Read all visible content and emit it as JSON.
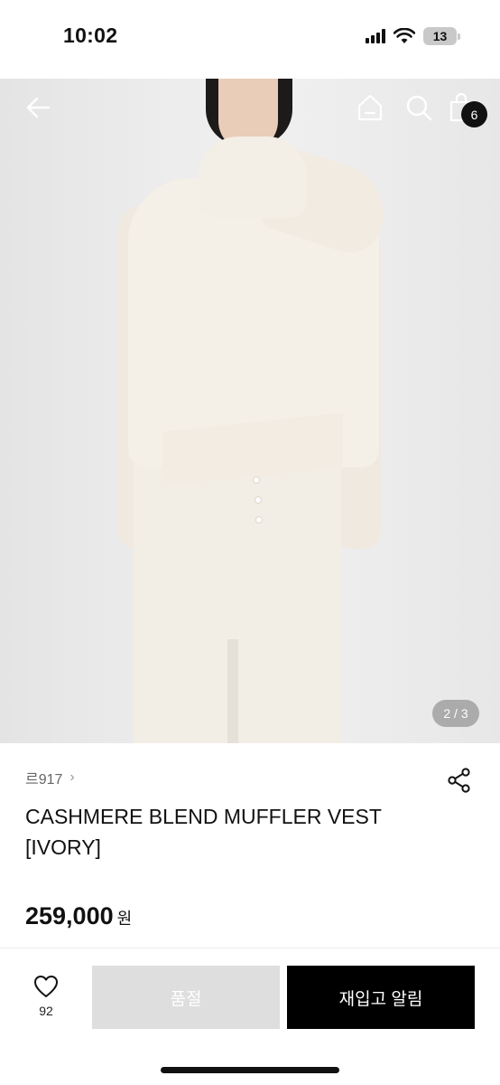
{
  "status_bar": {
    "time": "10:02",
    "battery": "13"
  },
  "header": {
    "bag_count": "6"
  },
  "gallery": {
    "indicator": "2 / 3"
  },
  "product": {
    "brand": "르917",
    "title": "CASHMERE BLEND MUFFLER VEST [IVORY]",
    "price": "259,000",
    "currency": "원"
  },
  "bottom_bar": {
    "like_count": "92",
    "sold_out_label": "품절",
    "restock_label": "재입고 알림"
  },
  "colors": {
    "accent": "#000000",
    "disabled": "#dedede",
    "badge": "#111111"
  }
}
